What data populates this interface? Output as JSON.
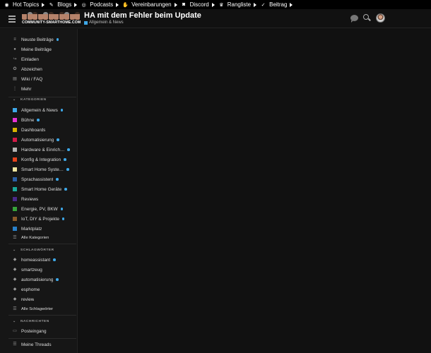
{
  "topbar": {
    "items": [
      {
        "label": "Hot Topics",
        "icon": "fire-icon",
        "glyph": "◉"
      },
      {
        "label": "Blogs",
        "icon": "pencil-icon",
        "glyph": "✎"
      },
      {
        "label": "Podcasts",
        "icon": "headphones-icon",
        "glyph": "◎"
      },
      {
        "label": "Vereinbarungen",
        "icon": "handshake-icon",
        "glyph": "✋"
      },
      {
        "label": "Discord",
        "icon": "discord-icon",
        "glyph": "◙"
      },
      {
        "label": "Rangliste",
        "icon": "trophy-icon",
        "glyph": "♛"
      },
      {
        "label": "Beitrag",
        "icon": "thumbs-up-icon",
        "glyph": "✓"
      }
    ]
  },
  "header": {
    "logo_text": "COMMUNITY-SMARTHOME.COM",
    "topic_title": "HA mit dem Fehler beim Update",
    "topic_category": "Allgemein & News",
    "topic_category_color": "#3ea8e8"
  },
  "sidebar": {
    "main_items": [
      {
        "label": "Neuste Beiträge",
        "icon": "layers-icon",
        "glyph": "≡",
        "dot": true
      },
      {
        "label": "Meine Beiträge",
        "icon": "user-icon",
        "glyph": "●",
        "dot": false
      },
      {
        "label": "Einladen",
        "icon": "share-icon",
        "glyph": "↪",
        "dot": false
      },
      {
        "label": "Abzeichen",
        "icon": "badge-icon",
        "glyph": "✪",
        "dot": false
      },
      {
        "label": "Wiki / FAQ",
        "icon": "book-icon",
        "glyph": "▤",
        "dot": false
      },
      {
        "label": "Mehr",
        "icon": "more-vertical-icon",
        "glyph": "⋮",
        "dot": false
      }
    ],
    "categories_heading": "KATEGORIEN",
    "categories": [
      {
        "label": "Allgemein & News",
        "color": "#3ea8e8",
        "dot": true
      },
      {
        "label": "Bühne",
        "color": "#e832d5",
        "dot": true
      },
      {
        "label": "Dashboards",
        "color": "#d8b300",
        "dot": false
      },
      {
        "label": "Automatisierung",
        "color": "#d21a47",
        "dot": true
      },
      {
        "label": "Hardware & Einrich…",
        "color": "#b3b3b3",
        "dot": true
      },
      {
        "label": "Konfig & Integration",
        "color": "#e5431c",
        "dot": true
      },
      {
        "label": "Smart Home Syste…",
        "color": "#efe6a0",
        "dot": true
      },
      {
        "label": "Sprachassistent",
        "color": "#2a5fa6",
        "dot": true
      },
      {
        "label": "Smart Home Geräte",
        "color": "#1aa89a",
        "dot": true
      },
      {
        "label": "Reviews",
        "color": "#4b2a8a",
        "dot": false
      },
      {
        "label": "Energie, PV, BKW",
        "color": "#37a33b",
        "dot": true
      },
      {
        "label": "IoT, DIY & Projekte",
        "color": "#8a5a2a",
        "dot": true
      },
      {
        "label": "Marktplatz",
        "color": "#2980c9",
        "dot": false
      }
    ],
    "all_categories": "Alle Kategorien",
    "tags_heading": "SCHLAGWÖRTER",
    "tags": [
      {
        "label": "homeassistant",
        "dot": true
      },
      {
        "label": "smartzeug",
        "dot": false
      },
      {
        "label": "automatisierung",
        "dot": true
      },
      {
        "label": "esphome",
        "dot": false
      },
      {
        "label": "review",
        "dot": false
      }
    ],
    "all_tags": "Alle Schlagwörter",
    "messages_heading": "NACHRICHTEN",
    "inbox": "Posteingang",
    "my_threads": "Meine Threads"
  }
}
